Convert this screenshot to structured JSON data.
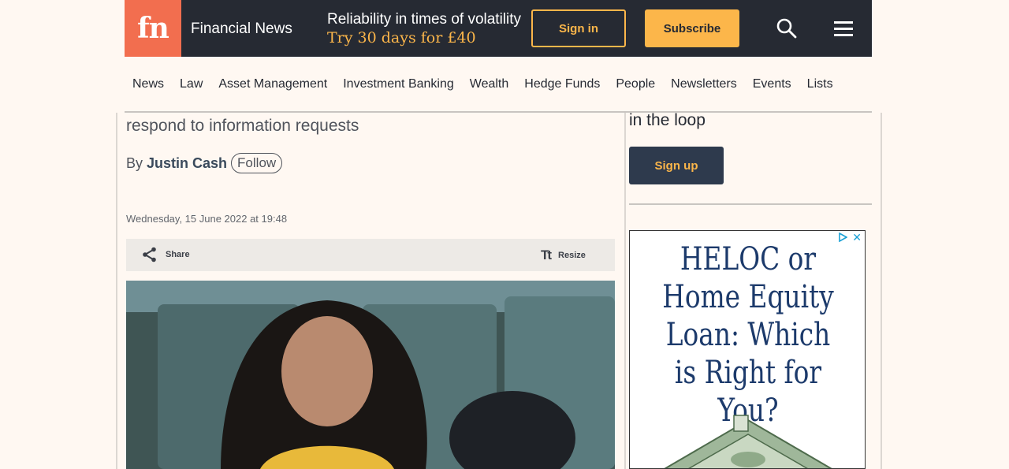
{
  "header": {
    "logo_text": "fn",
    "brand": "Financial News",
    "promo_line1": "Reliability in times of volatility",
    "promo_line2": "Try 30 days for £40",
    "signin_label": "Sign in",
    "subscribe_label": "Subscribe"
  },
  "nav": {
    "items": [
      "News",
      "Law",
      "Asset Management",
      "Investment Banking",
      "Wealth",
      "Hedge Funds",
      "People",
      "Newsletters",
      "Events",
      "Lists"
    ]
  },
  "article": {
    "standfirst": "respond to information requests",
    "byline_prefix": "By",
    "author": "Justin Cash",
    "follow_label": "Follow",
    "date": "Wednesday, 15 June 2022 at 19:48",
    "share_label": "Share",
    "resize_icon": "Tt",
    "resize_label": "Resize"
  },
  "sidebar": {
    "loop_text": "in the loop",
    "signup_label": "Sign up"
  },
  "ad": {
    "headline": "HELOC or Home Equity Loan: Which is Right for You?",
    "close_glyph": "✕"
  },
  "colors": {
    "header_bg": "#262a33",
    "logo_bg": "#f26e4f",
    "accent": "#fcb64a",
    "page_bg": "#fff8f2"
  }
}
